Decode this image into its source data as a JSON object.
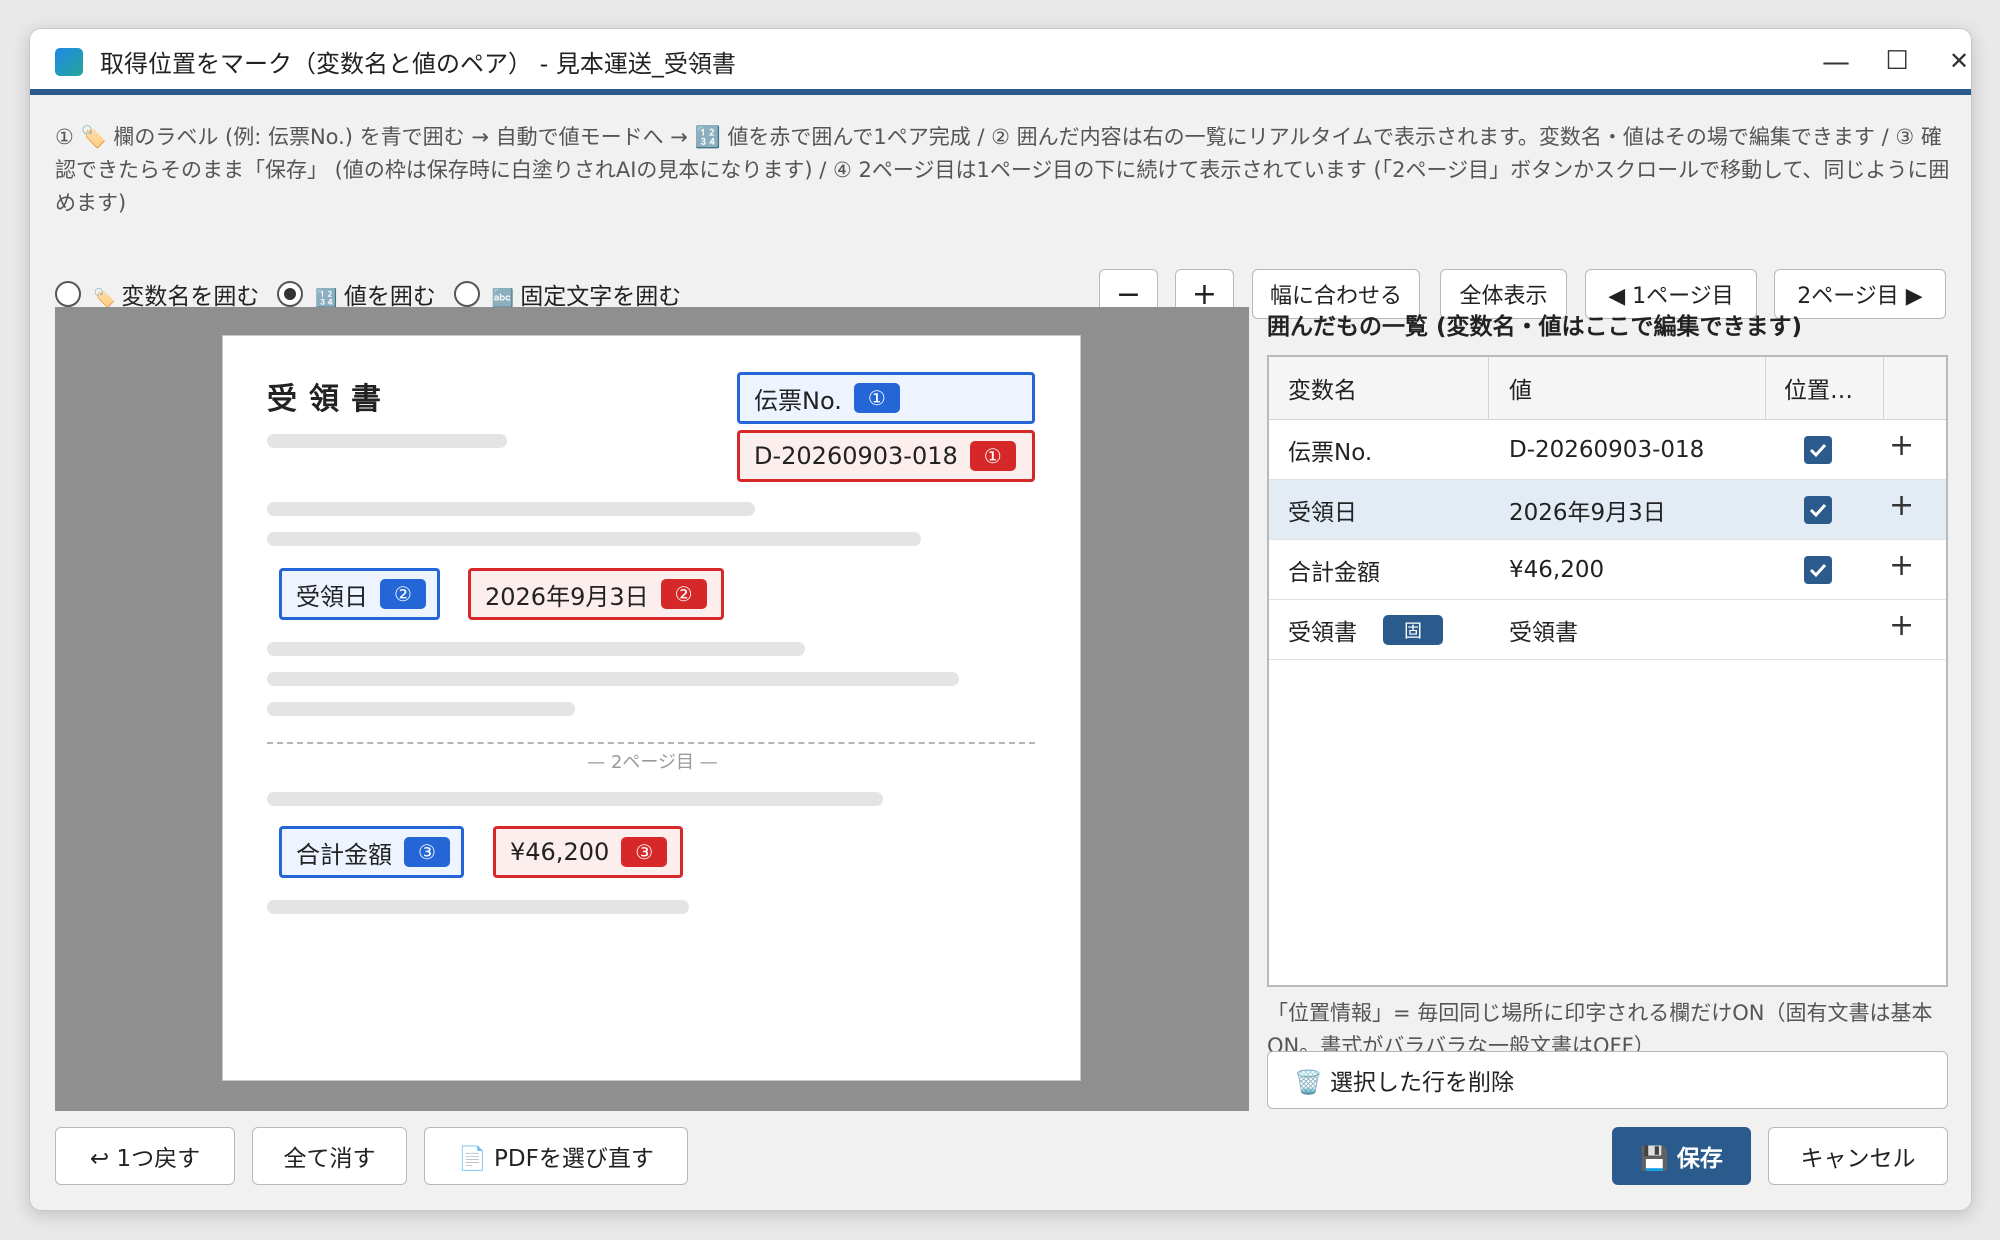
{
  "window": {
    "title": "取得位置をマーク（変数名と値のペア） - 見本運送_受領書",
    "minimize": "—",
    "maximize": "☐",
    "close": "✕"
  },
  "instructions": "① 🏷️ 欄のラベル (例: 伝票No.) を青で囲む → 自動で値モードへ → 🔢 値を赤で囲んで1ペア完成 / ② 囲んだ内容は右の一覧にリアルタイムで表示されます。変数名・値はその場で編集できます / ③ 確認できたらそのまま「保存」 (値の枠は保存時に白塗りされAIの見本になります) / ④ 2ページ目は1ページ目の下に続けて表示されています (「2ページ目」ボタンかスクロールで移動して、同じように囲めます)",
  "modes": [
    {
      "emoji": "🏷️",
      "label": "変数名を囲む",
      "selected": false
    },
    {
      "emoji": "🔢",
      "label": "値を囲む",
      "selected": true
    },
    {
      "emoji": "🔤",
      "label": "固定文字を囲む",
      "selected": false
    }
  ],
  "toolbar": {
    "zoom_out": "−",
    "zoom_in": "+",
    "fit_width": "幅に合わせる",
    "show_all": "全体表示",
    "page1": "◀ 1ページ目",
    "page2": "2ページ目 ▶"
  },
  "document": {
    "title": "受領書",
    "page2_divider": "— 2ページ目 —",
    "marks": {
      "label1": "伝票No.",
      "num1": "①",
      "value1": "D-20260903-018",
      "label2": "受領日",
      "num2": "②",
      "value2": "2026年9月3日",
      "label3": "合計金額",
      "num3": "③",
      "value3": "¥46,200"
    }
  },
  "panel": {
    "title": "囲んだもの一覧 (変数名・値はここで編集できます)",
    "columns": [
      "変数名",
      "値",
      "位置…",
      ""
    ],
    "rows": [
      {
        "name": "伝票No.",
        "value": "D-20260903-018",
        "position": true,
        "selected": false
      },
      {
        "name": "受領日",
        "value": "2026年9月3日",
        "position": true,
        "selected": true
      },
      {
        "name": "合計金額",
        "value": "¥46,200",
        "position": true,
        "selected": false
      },
      {
        "name": "受領書",
        "badge": "固",
        "value": "受領書",
        "position": false,
        "selected": false
      }
    ],
    "add_symbol": "+",
    "note": "「位置情報」= 毎回同じ場所に印字される欄だけON（固有文書は基本ON。書式がバラバラな一般文書はOFF）",
    "delete_button": "🗑️ 選択した行を削除"
  },
  "footer": {
    "undo": "↩ 1つ戻す",
    "clear_all": "全て消す",
    "reselect_pdf": "📄 PDFを選び直す",
    "save": "💾 保存",
    "cancel": "キャンセル"
  },
  "colors": {
    "accent": "#2b5b8c",
    "label_box": "#2466d6",
    "value_box": "#d62828"
  }
}
